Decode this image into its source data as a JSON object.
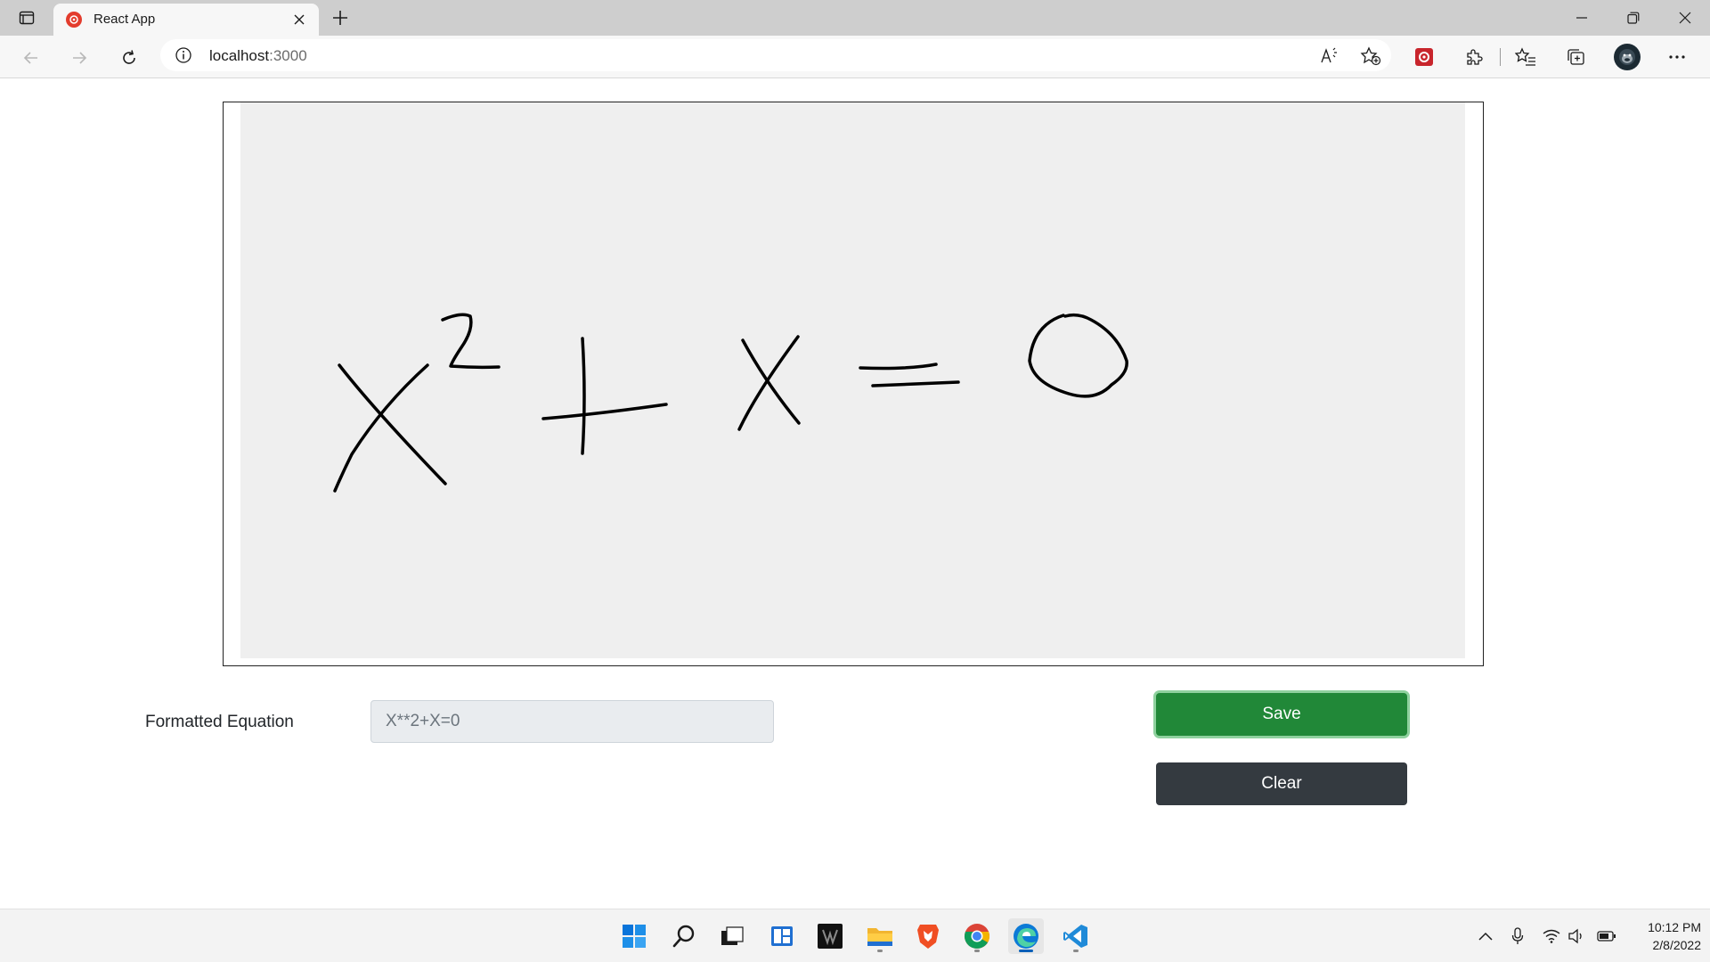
{
  "browser": {
    "tab_title": "React App",
    "url_host": "localhost",
    "url_port": ":3000"
  },
  "page": {
    "equation_label": "Formatted Equation",
    "equation_value": "X**2+X=0",
    "save_label": "Save",
    "clear_label": "Clear",
    "colors": {
      "save_button": "#218838",
      "clear_button": "#343a40",
      "canvas_background": "#efefef",
      "ink": "#000000"
    }
  },
  "taskbar": {
    "time": "10:12 PM",
    "date": "2/8/2022"
  },
  "icons": {
    "taskbar_apps": [
      "windows-start-icon",
      "search-icon",
      "task-view-icon",
      "widgets-icon",
      "predator-app-icon",
      "file-explorer-icon",
      "brave-browser-icon",
      "chrome-icon",
      "edge-icon",
      "vscode-icon"
    ],
    "tray": [
      "chevron-up-icon",
      "microphone-icon",
      "wifi-icon",
      "speaker-icon",
      "battery-icon"
    ]
  }
}
